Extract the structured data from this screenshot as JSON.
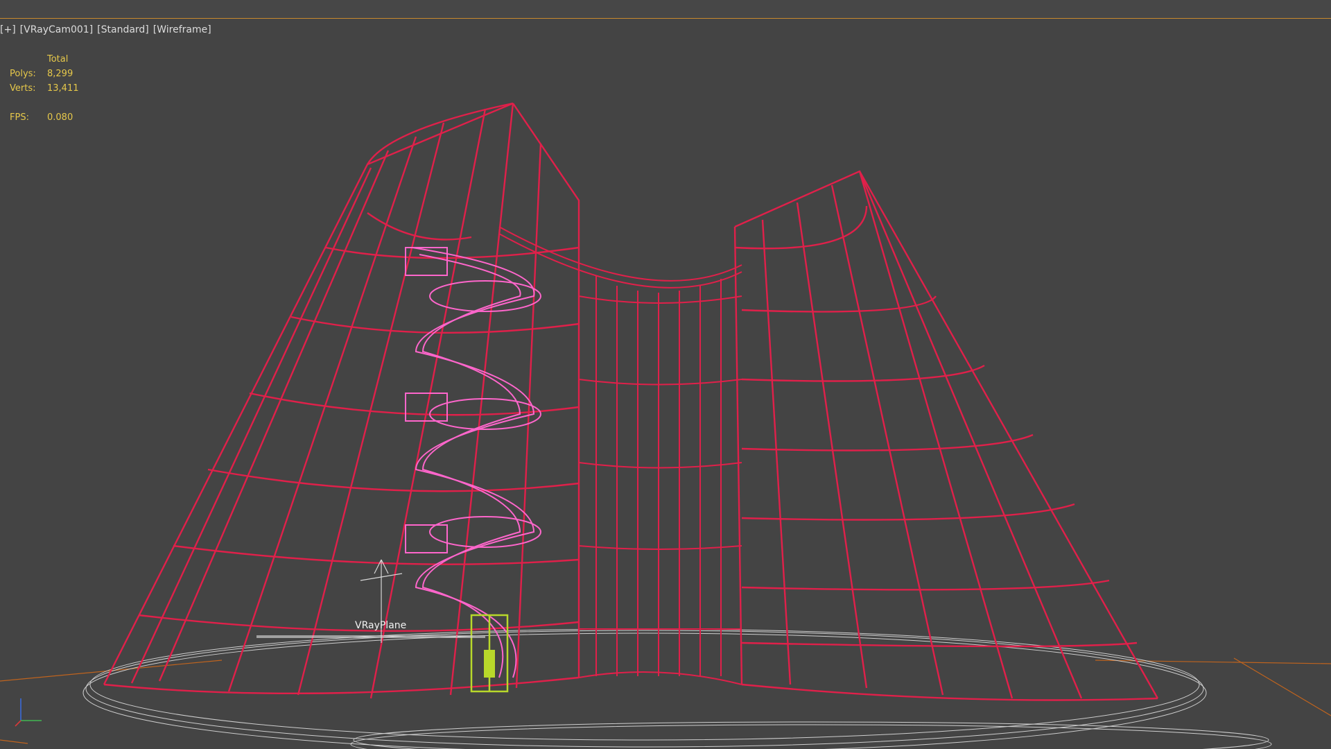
{
  "viewport": {
    "menu_plus": "[+]",
    "camera": "[VRayCam001]",
    "shading_mode": "[Standard]",
    "display_mode": "[Wireframe]"
  },
  "stats": {
    "header": "Total",
    "polys_label": "Polys:",
    "polys_value": "8,299",
    "verts_label": "Verts:",
    "verts_value": "13,411",
    "fps_label": "FPS:",
    "fps_value": "0.080"
  },
  "scene": {
    "object_label": "VRayPlane",
    "wire_color": "#e0204a",
    "stair_color": "#ff66cc",
    "selection_color": "#b8d82a",
    "ground_color": "#cfcfcf",
    "grid_color": "#c0641e",
    "axis_icons": [
      "x-axis-icon",
      "y-axis-icon",
      "z-axis-icon"
    ]
  },
  "colors": {
    "background": "#444444",
    "stats_text": "#e6c84a",
    "label_text": "#dcdcdc",
    "accent_border": "#c98a2e"
  }
}
